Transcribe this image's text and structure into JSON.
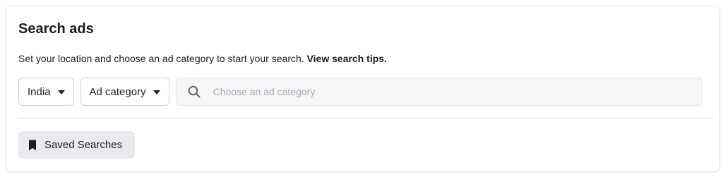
{
  "panel": {
    "title": "Search ads",
    "description": "Set your location and choose an ad category to start your search.",
    "tips_link": "View search tips."
  },
  "filters": {
    "country": "India",
    "category": "Ad category"
  },
  "search": {
    "placeholder": "Choose an ad category",
    "value": "",
    "icon": "search-icon"
  },
  "saved": {
    "label": "Saved Searches",
    "icon": "bookmark-icon"
  }
}
